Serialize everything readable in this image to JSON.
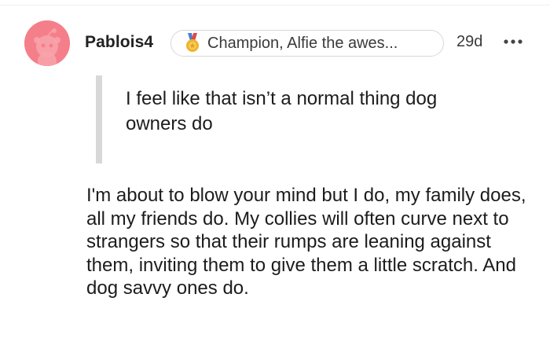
{
  "comment": {
    "author": "Pablois4",
    "flair": "Champion, Alfie the awes...",
    "flair_icon": "medal-icon",
    "age": "29d",
    "more_icon": "more-options-icon",
    "quote": "I feel like that isn’t a normal thing dog owners do",
    "body": "I'm about to blow your mind but I do, my family does, all my friends do. My collies will often curve next to strangers so that their rumps are leaning against them, inviting them to give them a little scratch. And dog savvy ones do."
  },
  "colors": {
    "avatar_bg": "#f47f8a",
    "quote_bar": "#d8d8d8",
    "medal_gold": "#f0b429",
    "medal_ribbon": "#4a7fd1"
  }
}
